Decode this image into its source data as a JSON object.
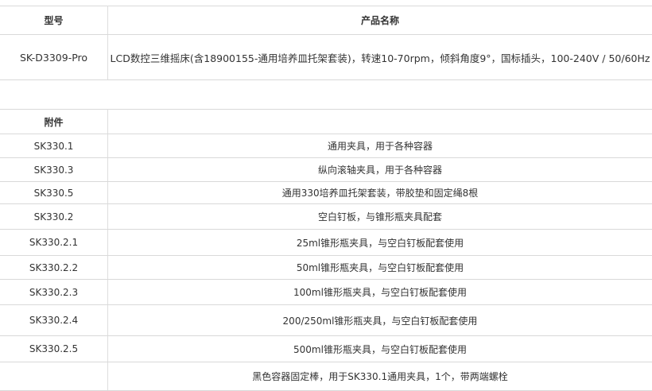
{
  "product_table": {
    "headers": [
      "型号",
      "产品名称"
    ],
    "row": {
      "model": "SK-D3309-Pro",
      "name": "LCD数控三维摇床(含18900155-通用培养皿托架套装)，转速10-70rpm，倾斜角度9°，国标插头，100-240V / 50/60Hz"
    }
  },
  "accessory_table": {
    "header": "附件",
    "rows": [
      {
        "model": "SK330.1",
        "desc": "通用夹具，用于各种容器"
      },
      {
        "model": "SK330.3",
        "desc": "纵向滚轴夹具，用于各种容器"
      },
      {
        "model": "SK330.5",
        "desc": "通用330培养皿托架套装，带胶垫和固定绳8根"
      },
      {
        "model": "SK330.2",
        "desc": "空白钉板，与锥形瓶夹具配套"
      },
      {
        "model": "SK330.2.1",
        "desc": "25ml锥形瓶夹具，与空白钉板配套使用"
      },
      {
        "model": "SK330.2.2",
        "desc": "50ml锥形瓶夹具，与空白钉板配套使用"
      },
      {
        "model": "SK330.2.3",
        "desc": "100ml锥形瓶夹具，与空白钉板配套使用"
      },
      {
        "model": "SK330.2.4",
        "desc": "200/250ml锥形瓶夹具，与空白钉板配套使用"
      },
      {
        "model": "SK330.2.5",
        "desc": "500ml锥形瓶夹具，与空白钉板配套使用"
      },
      {
        "model": "",
        "desc": "黑色容器固定棒，用于SK330.1通用夹具，1个，带两端螺栓"
      }
    ]
  }
}
